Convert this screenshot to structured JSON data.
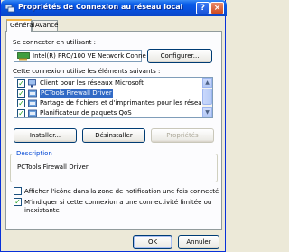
{
  "window": {
    "title": "Propriétés de Connexion au réseau local",
    "help_label": "?",
    "close_label": "×"
  },
  "tabs": [
    {
      "label": "Général",
      "active": true
    },
    {
      "label": "Avancé",
      "active": false
    }
  ],
  "connect_using": {
    "label": "Se connecter en utilisant :",
    "adapter": "Intel(R) PRO/100 VE Network Conne",
    "configure_label": "Configurer..."
  },
  "components": {
    "label": "Cette connexion utilise les éléments suivants :",
    "items": [
      {
        "label": "Client pour les réseaux Microsoft",
        "checked": true,
        "selected": false,
        "icon": "network-client-icon"
      },
      {
        "label": "PCTools Firewall Driver",
        "checked": true,
        "selected": true,
        "icon": "network-service-icon"
      },
      {
        "label": "Partage de fichiers et d'imprimantes pour les réseaux M",
        "checked": true,
        "selected": false,
        "icon": "network-service-icon"
      },
      {
        "label": "Planificateur de paquets QoS",
        "checked": true,
        "selected": false,
        "icon": "network-service-icon"
      }
    ],
    "install_label": "Installer...",
    "uninstall_label": "Désinstaller",
    "properties_label": "Propriétés"
  },
  "description": {
    "title": "Description",
    "text": "PCTools Firewall Driver"
  },
  "options": {
    "show_icon": {
      "label": "Afficher l'icône dans la zone de notification une fois connecté",
      "checked": false
    },
    "notify_limited": {
      "label_line1": "M'indiquer si cette connexion a une connectivité limitée ou",
      "label_line2": "inexistante",
      "checked": true
    }
  },
  "footer": {
    "ok_label": "OK",
    "cancel_label": "Annuler"
  },
  "colors": {
    "titlebar": "#0a5ce8",
    "selection": "#316ac5",
    "group_title": "#0046d5",
    "dialog_bg": "#ece9d8"
  }
}
